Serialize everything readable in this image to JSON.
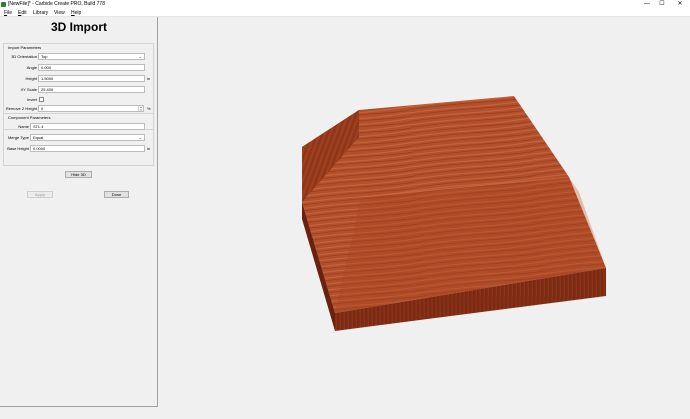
{
  "window": {
    "title": "[NewFile]* - Carbide Create PRO, Build 778",
    "controls": {
      "minimize": "—",
      "maximize": "☐",
      "close": "✕"
    }
  },
  "menu": [
    {
      "underline": "F",
      "rest": "ile"
    },
    {
      "underline": "E",
      "rest": "dit"
    },
    {
      "underline": "",
      "rest": "Library"
    },
    {
      "underline": "",
      "rest": "View"
    },
    {
      "underline": "H",
      "rest": "elp"
    }
  ],
  "panel": {
    "title": "3D Import",
    "import_params": {
      "title": "Import Parameters",
      "orientation_label": "3D Orientation",
      "orientation_value": "Top",
      "angle_label": "Angle",
      "angle_value": "0.000",
      "height_label": "Height",
      "height_value": "1.5000",
      "height_unit": "in",
      "xy_scale_label": "XY Scale",
      "xy_scale_value": "25.400",
      "invert_label": "Invert",
      "invert_checked": false,
      "remove_z_label": "Remove Z Height",
      "remove_z_value": "0",
      "remove_z_unit": "%"
    },
    "component_params": {
      "title": "Component Parameters",
      "name_label": "Name",
      "name_value": "STL 4",
      "merge_label": "Merge Type",
      "merge_value": "Equal",
      "base_label": "Base Height",
      "base_value": "0.0000",
      "base_unit": "in"
    },
    "hide_button": "Hide 3D",
    "apply_button": "Apply",
    "done_button": "Done"
  },
  "viewport": {
    "model": "wood-textured 3D component preview",
    "colors": {
      "top": "#b3502c",
      "front": "#7f2c14",
      "left": "#9a3d1e",
      "right": "#a5411f"
    }
  }
}
